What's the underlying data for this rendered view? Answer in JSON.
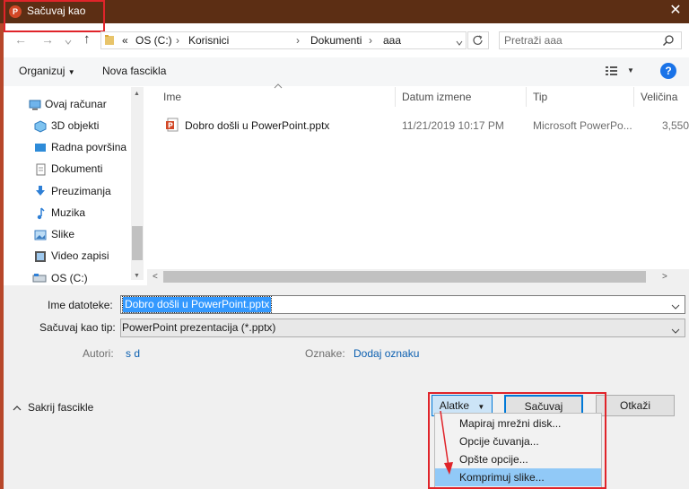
{
  "window": {
    "title": "Sačuvaj kao",
    "close_glyph": "✕",
    "app_icon_letter": "P"
  },
  "address": {
    "back_glyph": "←",
    "forward_glyph": "→",
    "up_glyph": "↑",
    "path_prefix": "«",
    "crumbs": [
      "OS (C:)",
      "Korisnici",
      "Dokumenti",
      "aaa"
    ],
    "separator": "›",
    "search_placeholder": "Pretraži aaa"
  },
  "toolbar": {
    "organize": "Organizuj",
    "new_folder": "Nova fascikla",
    "help": "?"
  },
  "nav_items": [
    {
      "label": "Ovaj računar",
      "icon": "computer-icon"
    },
    {
      "label": "3D objekti",
      "icon": "cube-icon"
    },
    {
      "label": "Radna površina",
      "icon": "desktop-icon"
    },
    {
      "label": "Dokumenti",
      "icon": "document-icon"
    },
    {
      "label": "Preuzimanja",
      "icon": "download-icon"
    },
    {
      "label": "Muzika",
      "icon": "music-icon"
    },
    {
      "label": "Slike",
      "icon": "picture-icon"
    },
    {
      "label": "Video zapisi",
      "icon": "video-icon"
    },
    {
      "label": "OS (C:)",
      "icon": "drive-icon"
    }
  ],
  "columns": {
    "name": "Ime",
    "date": "Datum izmene",
    "type": "Tip",
    "size": "Veličina"
  },
  "files": [
    {
      "name": "Dobro došli u PowerPoint.pptx",
      "date": "11/21/2019 10:17 PM",
      "type": "Microsoft PowerPo...",
      "size": "3,550"
    }
  ],
  "form": {
    "filename_label": "Ime datoteke:",
    "filename_value": "Dobro došli u PowerPoint.pptx",
    "savetype_label": "Sačuvaj kao tip:",
    "savetype_value": "PowerPoint prezentacija (*.pptx)",
    "authors_label": "Autori:",
    "authors_value": "s d",
    "tags_label": "Oznake:",
    "tags_value": "Dodaj oznaku"
  },
  "footer": {
    "hide_folders": "Sakrij fascikle",
    "tools": "Alatke",
    "save": "Sačuvaj",
    "cancel": "Otkaži"
  },
  "tools_menu": [
    "Mapiraj mrežni disk...",
    "Opcije čuvanja...",
    "Opšte opcije...",
    "Komprimuj slike..."
  ],
  "colors": {
    "titlebar": "#5c2e14",
    "highlight": "#e0242a",
    "selection": "#3399ff",
    "menu_hover": "#91c9f7"
  }
}
